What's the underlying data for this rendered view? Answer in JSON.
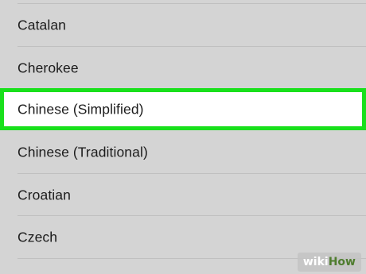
{
  "language_list": {
    "items": [
      {
        "label": "Catalan",
        "selected": false
      },
      {
        "label": "Cherokee",
        "selected": false
      },
      {
        "label": "Chinese (Simplified)",
        "selected": true
      },
      {
        "label": "Chinese (Traditional)",
        "selected": false
      },
      {
        "label": "Croatian",
        "selected": false
      },
      {
        "label": "Czech",
        "selected": false
      }
    ],
    "highlight_color": "#19e01c"
  },
  "watermark": {
    "part1": "wiki",
    "part2": "How",
    "part1_color": "#ffffff",
    "part2_color": "#4f7d2f"
  }
}
